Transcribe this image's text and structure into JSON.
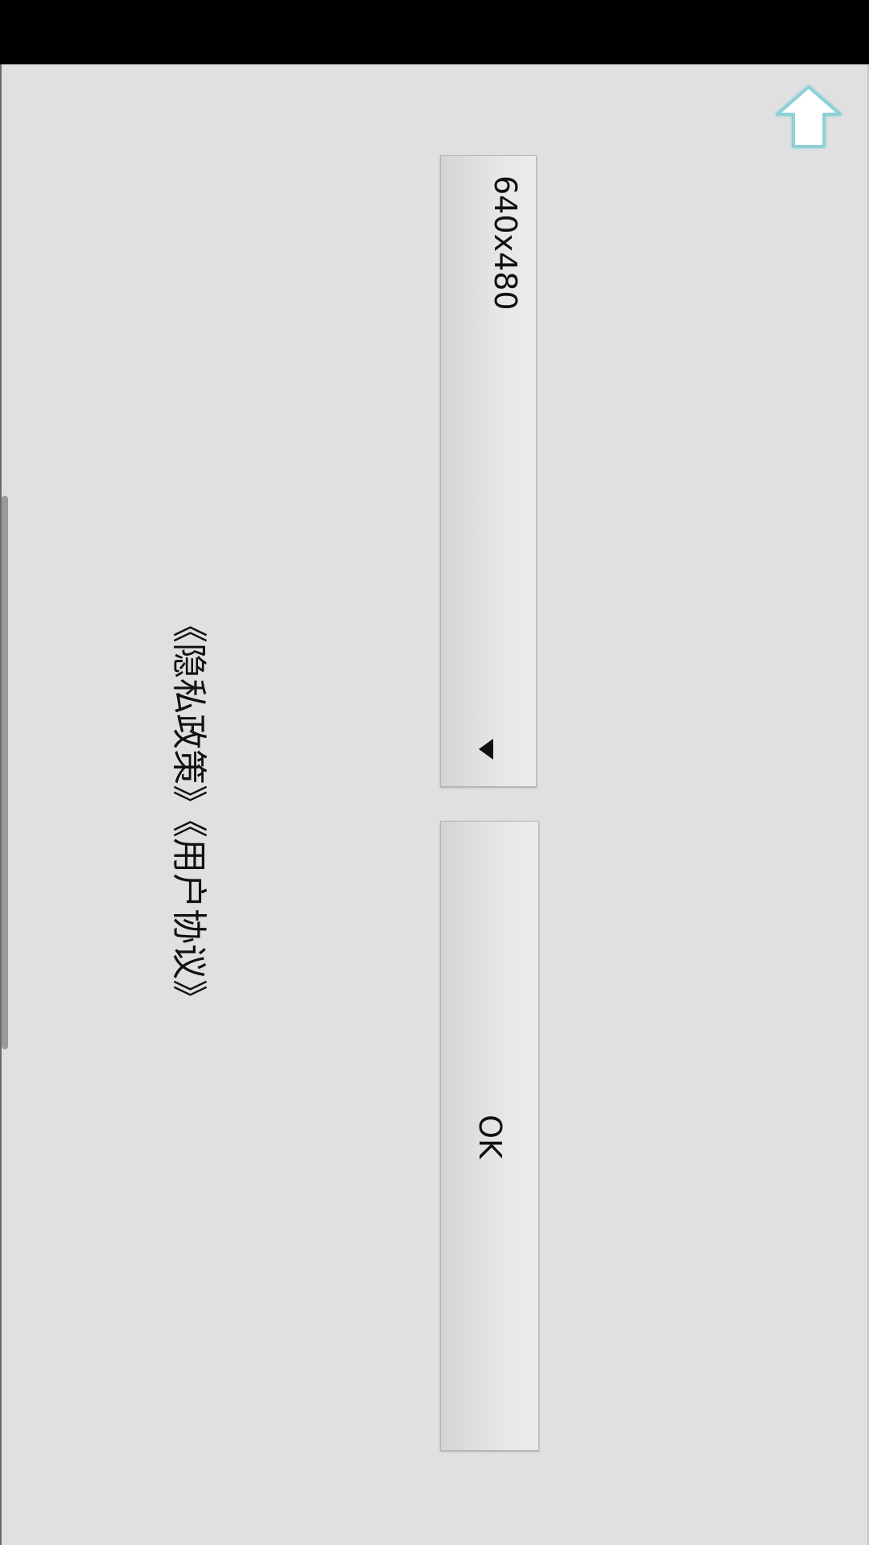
{
  "resolution_select": {
    "value": "640x480",
    "arrow_icon": "triangle-left-icon"
  },
  "ok_button": {
    "label": "OK"
  },
  "links": {
    "text": "《隐私政策》《用户协议》"
  },
  "up_button": {
    "icon": "up-arrow-icon",
    "fill": "#ffffff",
    "outline": "#8fd0d6"
  },
  "colors": {
    "background": "#e0e0e0",
    "status_bar": "#000000"
  }
}
